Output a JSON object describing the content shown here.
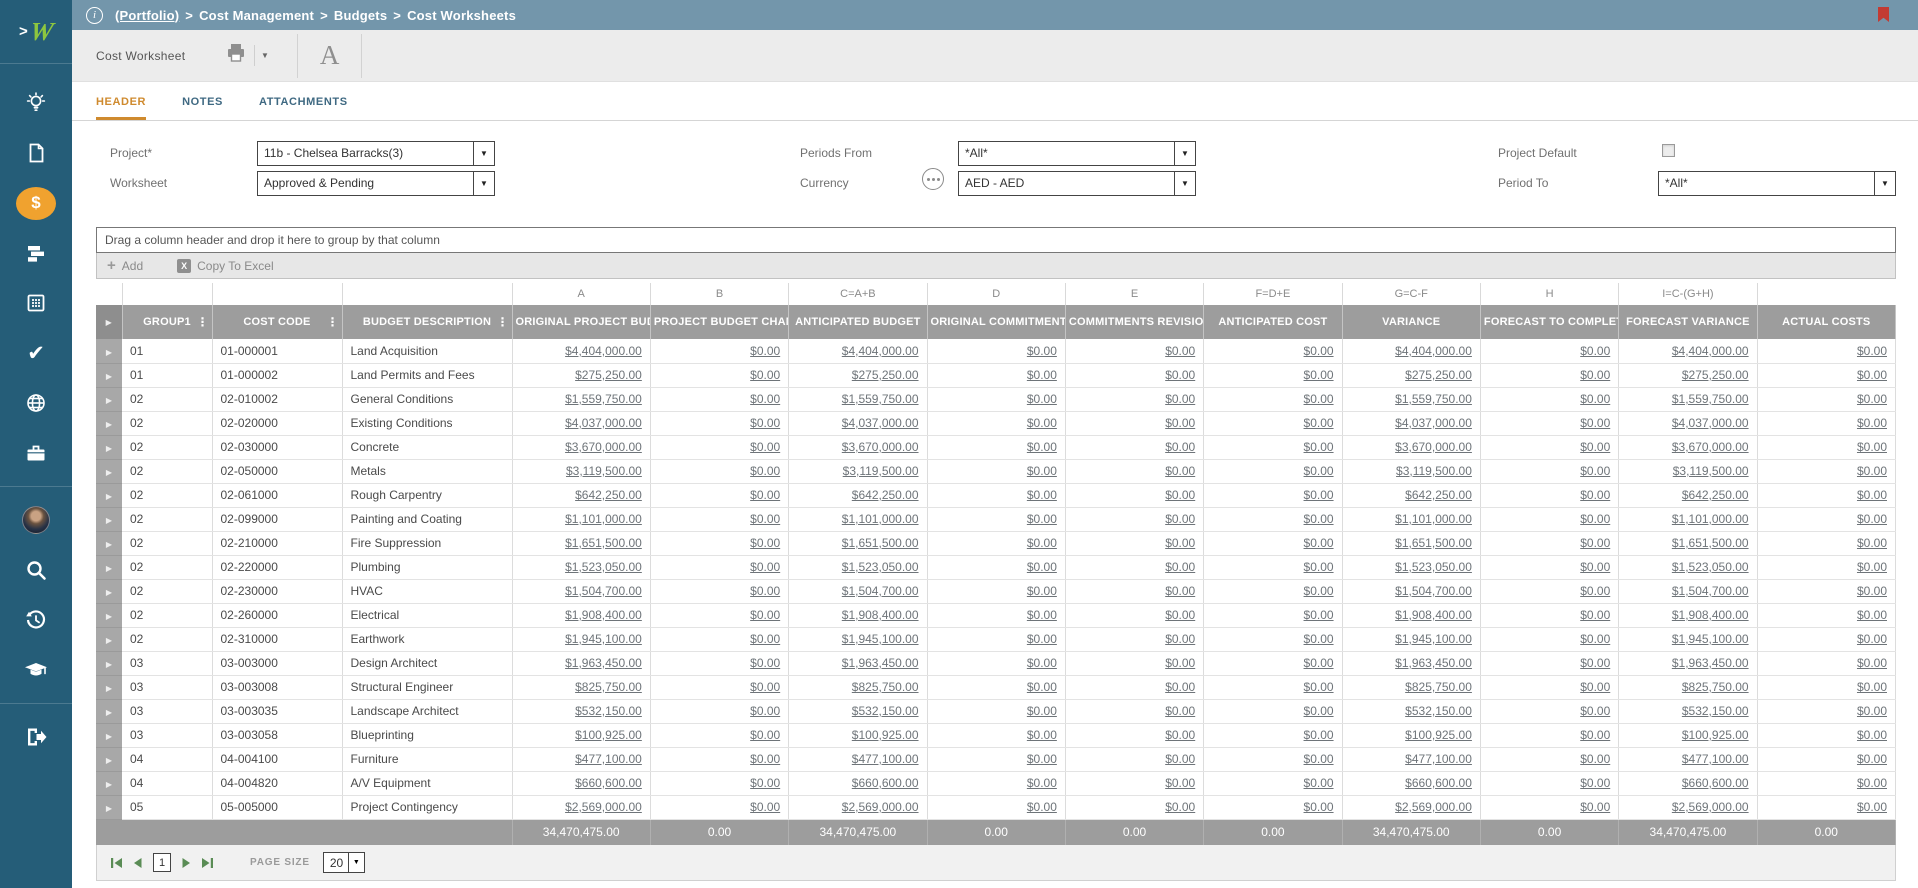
{
  "colors": {
    "sidebar": "#255d78",
    "topbar": "#7396ab",
    "accent_orange": "#f0a22f",
    "tab_active": "#cf8a2e",
    "grid_header": "#9d9d9d",
    "pager_green": "#5a8c55",
    "link": "#6e7479",
    "logo_green": "#8dc63f",
    "alert_red": "#c23b33"
  },
  "icons": {
    "info": "i",
    "chevron": ">",
    "caret": "▼",
    "expand": "▶",
    "menu": "⋮",
    "check": "✔",
    "plus": "+",
    "excel": "X",
    "dollar": "$"
  },
  "brand": {
    "logo_letter": "W"
  },
  "topbar": {
    "separator": ">",
    "items": [
      {
        "label": "(Portfolio)",
        "underline": true
      },
      {
        "label": "Cost Management",
        "underline": false
      },
      {
        "label": "Budgets",
        "underline": false
      },
      {
        "label": "Cost Worksheets",
        "underline": false
      }
    ]
  },
  "toolbar": {
    "title": "Cost Worksheet",
    "font_icon_letter": "A"
  },
  "tabs": {
    "items": [
      {
        "label": "HEADER",
        "active": true
      },
      {
        "label": "NOTES",
        "active": false
      },
      {
        "label": "ATTACHMENTS",
        "active": false
      }
    ]
  },
  "form": {
    "project_label": "Project*",
    "project_value": "11b - Chelsea Barracks(3)",
    "worksheet_label": "Worksheet",
    "worksheet_value": "Approved & Pending",
    "periods_from_label": "Periods From",
    "periods_from_value": "*All*",
    "currency_label": "Currency",
    "currency_value": "AED - AED",
    "project_default_label": "Project Default",
    "project_default_checked": false,
    "period_to_label": "Period To",
    "period_to_value": "*All*"
  },
  "grid": {
    "group_hint": "Drag a column header and drop it here to group by that column",
    "add_label": "Add",
    "copy_label": "Copy To Excel",
    "letter_row": [
      "",
      "",
      "",
      "",
      "A",
      "B",
      "C=A+B",
      "D",
      "E",
      "F=D+E",
      "G=C-F",
      "H",
      "I=C-(G+H)",
      ""
    ],
    "columns": [
      {
        "label": "GROUP1",
        "menu": true
      },
      {
        "label": "COST CODE",
        "menu": true
      },
      {
        "label": "BUDGET DESCRIPTION",
        "menu": true
      },
      {
        "label": "ORIGINAL PROJECT BUD",
        "menu": false
      },
      {
        "label": "PROJECT BUDGET CHAN",
        "menu": false
      },
      {
        "label": "ANTICIPATED BUDGET",
        "menu": false
      },
      {
        "label": "ORIGINAL COMMITMENT",
        "menu": false
      },
      {
        "label": "COMMITMENTS REVISIO",
        "menu": false
      },
      {
        "label": "ANTICIPATED COST",
        "menu": false
      },
      {
        "label": "VARIANCE",
        "menu": false
      },
      {
        "label": "FORECAST TO COMPLET",
        "menu": false
      },
      {
        "label": "FORECAST VARIANCE",
        "menu": false
      },
      {
        "label": "ACTUAL COSTS",
        "menu": false
      }
    ],
    "rows": [
      {
        "group": "01",
        "code": "01-000001",
        "desc": "Land Acquisition",
        "values": [
          "$4,404,000.00",
          "$0.00",
          "$4,404,000.00",
          "$0.00",
          "$0.00",
          "$0.00",
          "$4,404,000.00",
          "$0.00",
          "$4,404,000.00",
          "$0.00"
        ]
      },
      {
        "group": "01",
        "code": "01-000002",
        "desc": "Land Permits and Fees",
        "values": [
          "$275,250.00",
          "$0.00",
          "$275,250.00",
          "$0.00",
          "$0.00",
          "$0.00",
          "$275,250.00",
          "$0.00",
          "$275,250.00",
          "$0.00"
        ]
      },
      {
        "group": "02",
        "code": "02-010002",
        "desc": "General Conditions",
        "values": [
          "$1,559,750.00",
          "$0.00",
          "$1,559,750.00",
          "$0.00",
          "$0.00",
          "$0.00",
          "$1,559,750.00",
          "$0.00",
          "$1,559,750.00",
          "$0.00"
        ]
      },
      {
        "group": "02",
        "code": "02-020000",
        "desc": "Existing Conditions",
        "values": [
          "$4,037,000.00",
          "$0.00",
          "$4,037,000.00",
          "$0.00",
          "$0.00",
          "$0.00",
          "$4,037,000.00",
          "$0.00",
          "$4,037,000.00",
          "$0.00"
        ]
      },
      {
        "group": "02",
        "code": "02-030000",
        "desc": "Concrete",
        "values": [
          "$3,670,000.00",
          "$0.00",
          "$3,670,000.00",
          "$0.00",
          "$0.00",
          "$0.00",
          "$3,670,000.00",
          "$0.00",
          "$3,670,000.00",
          "$0.00"
        ]
      },
      {
        "group": "02",
        "code": "02-050000",
        "desc": "Metals",
        "values": [
          "$3,119,500.00",
          "$0.00",
          "$3,119,500.00",
          "$0.00",
          "$0.00",
          "$0.00",
          "$3,119,500.00",
          "$0.00",
          "$3,119,500.00",
          "$0.00"
        ]
      },
      {
        "group": "02",
        "code": "02-061000",
        "desc": "Rough Carpentry",
        "values": [
          "$642,250.00",
          "$0.00",
          "$642,250.00",
          "$0.00",
          "$0.00",
          "$0.00",
          "$642,250.00",
          "$0.00",
          "$642,250.00",
          "$0.00"
        ]
      },
      {
        "group": "02",
        "code": "02-099000",
        "desc": "Painting and Coating",
        "values": [
          "$1,101,000.00",
          "$0.00",
          "$1,101,000.00",
          "$0.00",
          "$0.00",
          "$0.00",
          "$1,101,000.00",
          "$0.00",
          "$1,101,000.00",
          "$0.00"
        ]
      },
      {
        "group": "02",
        "code": "02-210000",
        "desc": "Fire Suppression",
        "values": [
          "$1,651,500.00",
          "$0.00",
          "$1,651,500.00",
          "$0.00",
          "$0.00",
          "$0.00",
          "$1,651,500.00",
          "$0.00",
          "$1,651,500.00",
          "$0.00"
        ]
      },
      {
        "group": "02",
        "code": "02-220000",
        "desc": "Plumbing",
        "values": [
          "$1,523,050.00",
          "$0.00",
          "$1,523,050.00",
          "$0.00",
          "$0.00",
          "$0.00",
          "$1,523,050.00",
          "$0.00",
          "$1,523,050.00",
          "$0.00"
        ]
      },
      {
        "group": "02",
        "code": "02-230000",
        "desc": "HVAC",
        "values": [
          "$1,504,700.00",
          "$0.00",
          "$1,504,700.00",
          "$0.00",
          "$0.00",
          "$0.00",
          "$1,504,700.00",
          "$0.00",
          "$1,504,700.00",
          "$0.00"
        ]
      },
      {
        "group": "02",
        "code": "02-260000",
        "desc": "Electrical",
        "values": [
          "$1,908,400.00",
          "$0.00",
          "$1,908,400.00",
          "$0.00",
          "$0.00",
          "$0.00",
          "$1,908,400.00",
          "$0.00",
          "$1,908,400.00",
          "$0.00"
        ]
      },
      {
        "group": "02",
        "code": "02-310000",
        "desc": "Earthwork",
        "values": [
          "$1,945,100.00",
          "$0.00",
          "$1,945,100.00",
          "$0.00",
          "$0.00",
          "$0.00",
          "$1,945,100.00",
          "$0.00",
          "$1,945,100.00",
          "$0.00"
        ]
      },
      {
        "group": "03",
        "code": "03-003000",
        "desc": "Design Architect",
        "values": [
          "$1,963,450.00",
          "$0.00",
          "$1,963,450.00",
          "$0.00",
          "$0.00",
          "$0.00",
          "$1,963,450.00",
          "$0.00",
          "$1,963,450.00",
          "$0.00"
        ]
      },
      {
        "group": "03",
        "code": "03-003008",
        "desc": "Structural Engineer",
        "values": [
          "$825,750.00",
          "$0.00",
          "$825,750.00",
          "$0.00",
          "$0.00",
          "$0.00",
          "$825,750.00",
          "$0.00",
          "$825,750.00",
          "$0.00"
        ]
      },
      {
        "group": "03",
        "code": "03-003035",
        "desc": "Landscape Architect",
        "values": [
          "$532,150.00",
          "$0.00",
          "$532,150.00",
          "$0.00",
          "$0.00",
          "$0.00",
          "$532,150.00",
          "$0.00",
          "$532,150.00",
          "$0.00"
        ]
      },
      {
        "group": "03",
        "code": "03-003058",
        "desc": "Blueprinting",
        "values": [
          "$100,925.00",
          "$0.00",
          "$100,925.00",
          "$0.00",
          "$0.00",
          "$0.00",
          "$100,925.00",
          "$0.00",
          "$100,925.00",
          "$0.00"
        ]
      },
      {
        "group": "04",
        "code": "04-004100",
        "desc": "Furniture",
        "values": [
          "$477,100.00",
          "$0.00",
          "$477,100.00",
          "$0.00",
          "$0.00",
          "$0.00",
          "$477,100.00",
          "$0.00",
          "$477,100.00",
          "$0.00"
        ]
      },
      {
        "group": "04",
        "code": "04-004820",
        "desc": "A/V Equipment",
        "values": [
          "$660,600.00",
          "$0.00",
          "$660,600.00",
          "$0.00",
          "$0.00",
          "$0.00",
          "$660,600.00",
          "$0.00",
          "$660,600.00",
          "$0.00"
        ]
      },
      {
        "group": "05",
        "code": "05-005000",
        "desc": "Project Contingency",
        "values": [
          "$2,569,000.00",
          "$0.00",
          "$2,569,000.00",
          "$0.00",
          "$0.00",
          "$0.00",
          "$2,569,000.00",
          "$0.00",
          "$2,569,000.00",
          "$0.00"
        ]
      }
    ],
    "totals": [
      "34,470,475.00",
      "0.00",
      "34,470,475.00",
      "0.00",
      "0.00",
      "0.00",
      "34,470,475.00",
      "0.00",
      "34,470,475.00",
      "0.00"
    ],
    "pager": {
      "page": "1",
      "page_size_label": "PAGE SIZE",
      "page_size": "20"
    }
  }
}
